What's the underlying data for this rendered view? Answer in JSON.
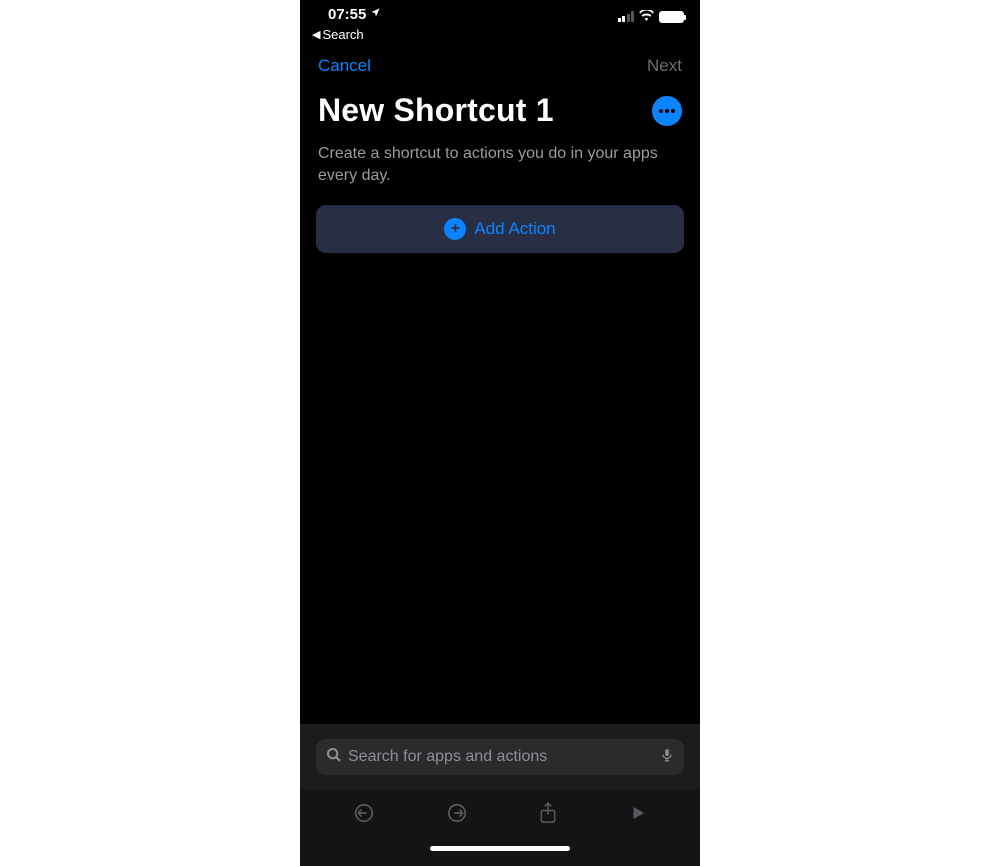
{
  "status_bar": {
    "time": "07:55",
    "back_label": "Search"
  },
  "nav": {
    "cancel": "Cancel",
    "next": "Next"
  },
  "header": {
    "title": "New Shortcut 1",
    "subtitle": "Create a shortcut to actions you do in your apps every day."
  },
  "add_action": {
    "label": "Add Action"
  },
  "search": {
    "placeholder": "Search for apps and actions"
  },
  "colors": {
    "accent": "#0a84ff"
  }
}
